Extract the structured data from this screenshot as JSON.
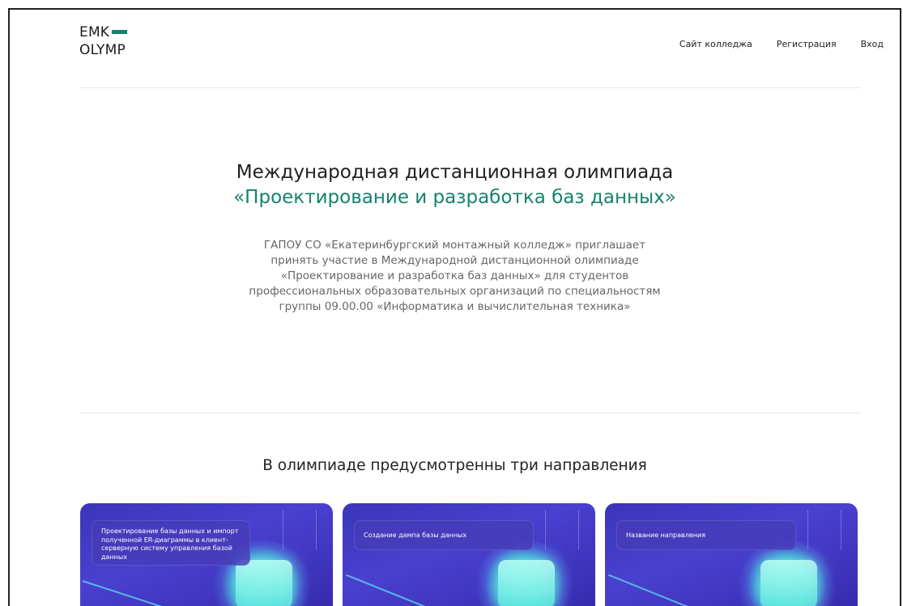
{
  "header": {
    "logo_line1": "EMK",
    "logo_line2": "OLYMP",
    "nav": {
      "college_site": "Сайт колледжа",
      "registration": "Регистрация",
      "login": "Вход"
    }
  },
  "hero": {
    "title_line1": "Международная дистанционная олимпиада",
    "title_line2": "«Проектирование и разработка баз данных»",
    "description_lines": [
      "ГАПОУ СО «Екатеринбургский монтажный колледж» приглашает",
      "принять участие в Международной дистанционной олимпиаде",
      "«Проектирование и разработка баз данных» для студентов",
      "профессиональных образовательных организаций по специальностям",
      "группы 09.00.00 «Информатика и вычислительная техника»"
    ]
  },
  "directions": {
    "title": "В олимпиаде предусмотренны три направления",
    "cards": [
      {
        "label": "Проектирование базы данных и импорт полученной ER-диаграммы в клиент-серверную систему управления базой данных"
      },
      {
        "label": "Создание дампа базы данных"
      },
      {
        "label": "Название направления"
      }
    ]
  },
  "colors": {
    "accent": "#15826d",
    "card_bg": "#3f38c4",
    "glow": "#5de6df"
  }
}
